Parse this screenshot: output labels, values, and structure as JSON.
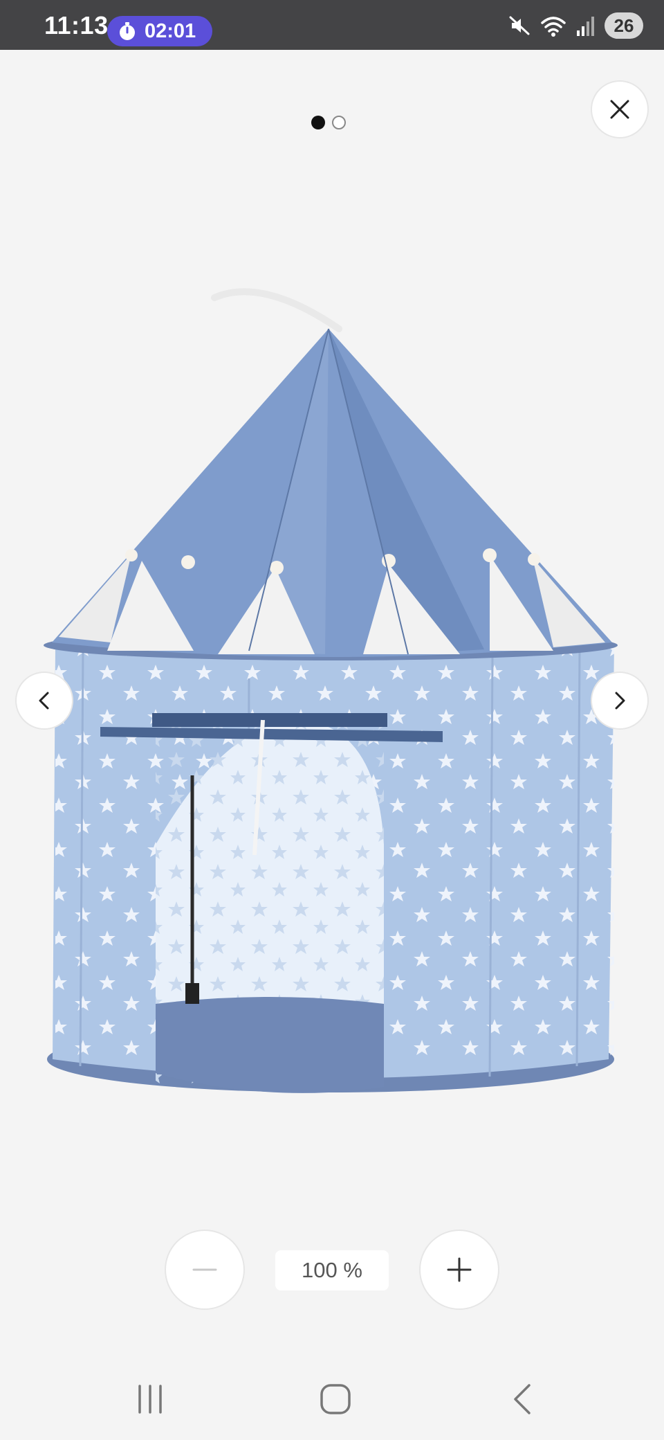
{
  "status_bar": {
    "time": "11:13",
    "timer": "02:01",
    "battery": "26",
    "icons": [
      "mute-icon",
      "wifi-icon",
      "signal-icon"
    ],
    "timer_color": "#5b4fd9"
  },
  "viewer": {
    "page_count": 2,
    "current_page": 1,
    "close_icon": "close-icon",
    "prev_icon": "chevron-left-icon",
    "next_icon": "chevron-right-icon",
    "image_subject": "tent"
  },
  "zoom": {
    "level": "100 %",
    "zoom_out_icon": "minus-icon",
    "zoom_in_icon": "plus-icon"
  },
  "nav_bar": {
    "icons": [
      "recent-apps-icon",
      "home-icon",
      "back-icon"
    ]
  }
}
